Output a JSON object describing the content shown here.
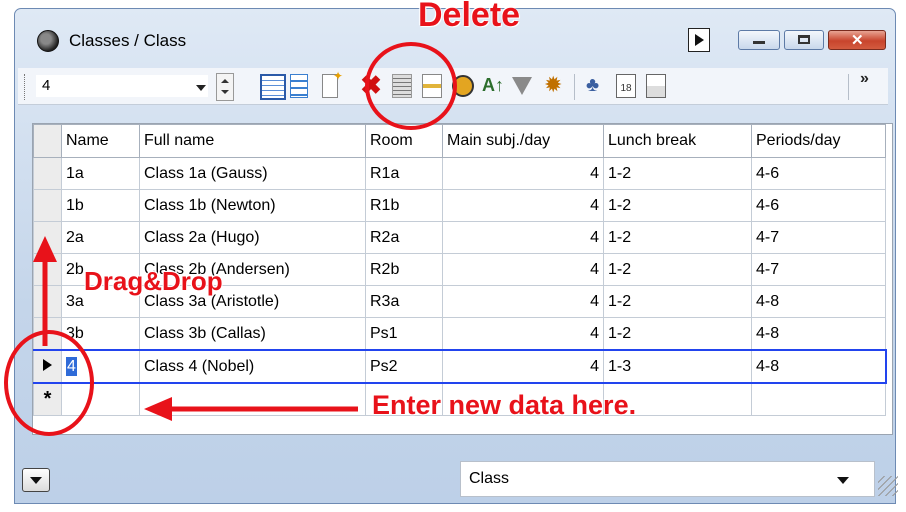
{
  "window": {
    "title": "Classes / Class",
    "controls": [
      "minimize",
      "maximize",
      "close"
    ]
  },
  "toolbar": {
    "combo_value": "4",
    "icons": [
      "grid-add-icon",
      "grid-remove-icon",
      "new-row-icon",
      "delete-icon",
      "table-icon",
      "table-edit-icon",
      "clock-icon",
      "sort-icon",
      "filter-icon",
      "settings-gear-icon",
      "person-icon",
      "calendar-icon",
      "copy-icon"
    ],
    "overflow_label": "»"
  },
  "table": {
    "columns": [
      "Name",
      "Full name",
      "Room",
      "Main subj./day",
      "Lunch break",
      "Periods/day"
    ],
    "rows": [
      [
        "1a",
        "Class 1a (Gauss)",
        "R1a",
        "4",
        "1-2",
        "4-6"
      ],
      [
        "1b",
        "Class 1b (Newton)",
        "R1b",
        "4",
        "1-2",
        "4-6"
      ],
      [
        "2a",
        "Class 2a (Hugo)",
        "R2a",
        "4",
        "1-2",
        "4-7"
      ],
      [
        "2b",
        "Class 2b (Andersen)",
        "R2b",
        "4",
        "1-2",
        "4-7"
      ],
      [
        "3a",
        "Class 3a (Aristotle)",
        "R3a",
        "4",
        "1-2",
        "4-8"
      ],
      [
        "3b",
        "Class 3b (Callas)",
        "Ps1",
        "4",
        "1-2",
        "4-8"
      ],
      [
        "4",
        "Class 4 (Nobel)",
        "Ps2",
        "4",
        "1-3",
        "4-8"
      ]
    ],
    "new_row_marker": "*",
    "selected_row_index": 6
  },
  "annotations": {
    "delete": "Delete",
    "drag_drop": "Drag&Drop",
    "enter_new": "Enter new data here."
  },
  "footer": {
    "select_value": "Class"
  },
  "colors": {
    "annotation": "#e8121a",
    "selection_border": "#2244ee",
    "cell_highlight": "#2f6bd8"
  }
}
